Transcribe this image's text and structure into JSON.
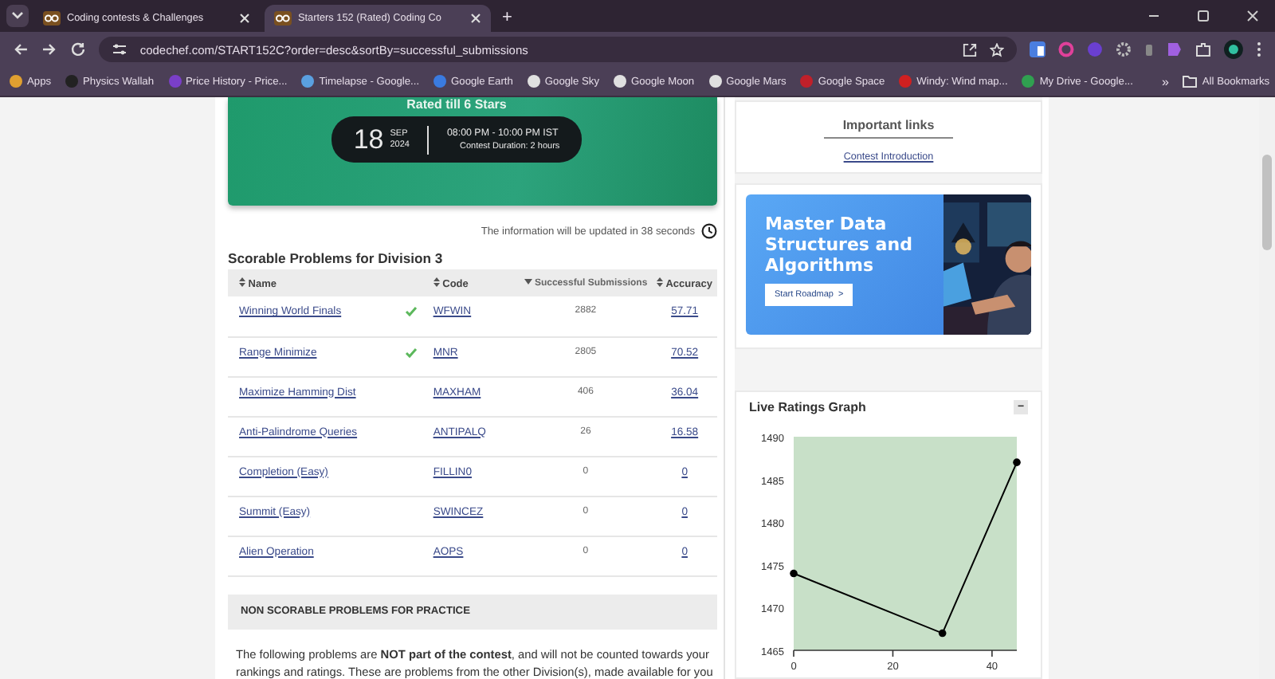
{
  "browser": {
    "tabs": [
      {
        "title": "Coding contests & Challenges",
        "selected": false
      },
      {
        "title": "Starters 152 (Rated) Coding Co",
        "selected": true
      }
    ],
    "new_tab": "+",
    "url": "codechef.com/START152C?order=desc&sortBy=successful_submissions",
    "bookmarks": [
      {
        "label": "Apps",
        "color": "#e0a030"
      },
      {
        "label": "Physics Wallah",
        "color": "#222222"
      },
      {
        "label": "Price History - Price...",
        "color": "#7a3fc8"
      },
      {
        "label": "Timelapse - Google...",
        "color": "#5aa0e0"
      },
      {
        "label": "Google Earth",
        "color": "#3a7be0"
      },
      {
        "label": "Google Sky",
        "color": "#e0e0e0"
      },
      {
        "label": "Google Moon",
        "color": "#e0e0e0"
      },
      {
        "label": "Google Mars",
        "color": "#e0e0e0"
      },
      {
        "label": "Google Space",
        "color": "#c0202a"
      },
      {
        "label": "Windy: Wind map...",
        "color": "#d02020"
      },
      {
        "label": "My Drive - Google...",
        "color": "#30a050"
      }
    ],
    "more": "»",
    "all_bookmarks": "All Bookmarks"
  },
  "banner": {
    "subtitle": "Rated till 6 Stars",
    "day": "18",
    "month": "SEP",
    "year": "2024",
    "time": "08:00 PM - 10:00 PM IST",
    "duration": "Contest Duration: 2 hours"
  },
  "update_notice": "The information will be updated in 38 seconds",
  "scorable": {
    "title": "Scorable Problems for Division 3",
    "columns": [
      {
        "label": "Name",
        "sorted": false
      },
      {
        "label": "Code",
        "sorted": false
      },
      {
        "label": "Successful Submissions",
        "sorted": true
      },
      {
        "label": "Accuracy",
        "sorted": false
      }
    ],
    "rows": [
      {
        "name": "Winning World Finals",
        "solved": true,
        "code": "WFWIN",
        "submissions": "2882",
        "accuracy": "57.71"
      },
      {
        "name": "Range Minimize",
        "solved": true,
        "code": "MNR",
        "submissions": "2805",
        "accuracy": "70.52"
      },
      {
        "name": "Maximize Hamming Dist",
        "solved": false,
        "code": "MAXHAM",
        "submissions": "406",
        "accuracy": "36.04"
      },
      {
        "name": "Anti-Palindrome Queries",
        "solved": false,
        "code": "ANTIPALQ",
        "submissions": "26",
        "accuracy": "16.58"
      },
      {
        "name": "Completion (Easy)",
        "solved": false,
        "code": "FILLIN0",
        "submissions": "0",
        "accuracy": "0"
      },
      {
        "name": "Summit (Easy)",
        "solved": false,
        "code": "SWINCEZ",
        "submissions": "0",
        "accuracy": "0"
      },
      {
        "name": "Alien Operation",
        "solved": false,
        "code": "AOPS",
        "submissions": "0",
        "accuracy": "0"
      }
    ]
  },
  "non_scorable": {
    "title": "NON SCORABLE PROBLEMS FOR PRACTICE",
    "text": "The following problems are **NOT part of the contest**, and will not be counted towards your rankings and ratings. These are problems from the other Division(s), made available for you"
  },
  "important_links": {
    "title": "Important links",
    "links": [
      "Contest Introduction"
    ]
  },
  "ad": {
    "title": "Master Data Structures and Algorithms",
    "button": "Start Roadmap  >"
  },
  "ratings": {
    "title": "Live Ratings Graph",
    "collapse": "−",
    "chart_data": {
      "type": "line",
      "x": [
        0,
        30,
        45
      ],
      "series": [
        {
          "color": "#000000",
          "marker": "circle",
          "values": [
            1474,
            1467,
            1487
          ]
        }
      ],
      "xlim": [
        0,
        45
      ],
      "ylim": [
        1465,
        1490
      ],
      "xticks": [
        0,
        20,
        40
      ],
      "yticks": [
        1465,
        1470,
        1475,
        1480,
        1485,
        1490
      ]
    }
  }
}
